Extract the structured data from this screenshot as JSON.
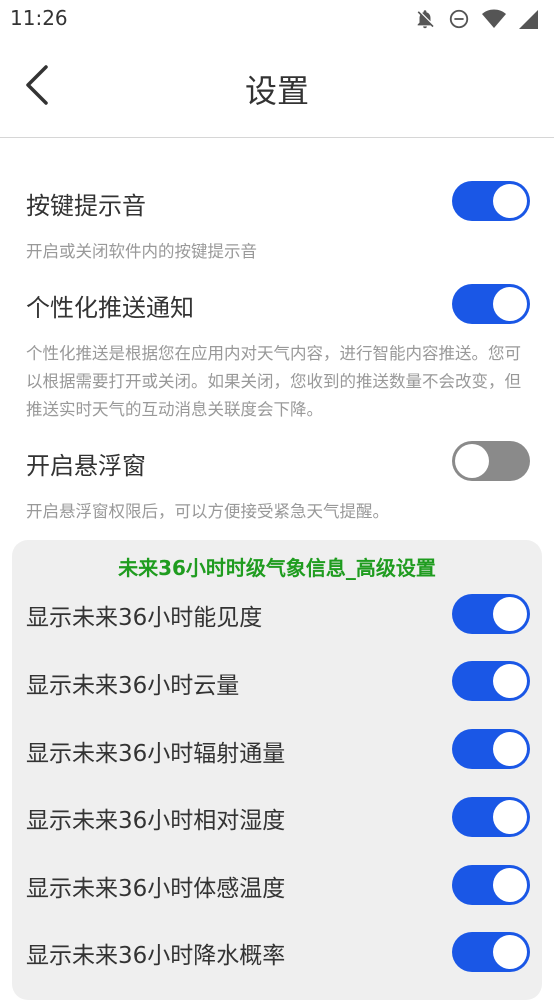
{
  "status_bar": {
    "time": "11:26",
    "icons": [
      "notifications-off-icon",
      "do-not-disturb-icon",
      "wifi-icon",
      "signal-icon"
    ]
  },
  "app_bar": {
    "title": "设置",
    "back_icon": "chevron-left-icon"
  },
  "settings": [
    {
      "title": "按键提示音",
      "description": "开启或关闭软件内的按键提示音",
      "enabled": true
    },
    {
      "title": "个性化推送通知",
      "description": "个性化推送是根据您在应用内对天气内容，进行智能内容推送。您可以根据需要打开或关闭。如果关闭，您收到的推送数量不会改变，但推送实时天气的互动消息关联度会下降。",
      "enabled": true
    },
    {
      "title": "开启悬浮窗",
      "description": "开启悬浮窗权限后，可以方便接受紧急天气提醒。",
      "enabled": false
    }
  ],
  "advanced": {
    "title": "未来36小时时级气象信息_高级设置",
    "title_color": "#1f9c1f",
    "items": [
      {
        "label": "显示未来36小时能见度",
        "enabled": true
      },
      {
        "label": "显示未来36小时云量",
        "enabled": true
      },
      {
        "label": "显示未来36小时辐射通量",
        "enabled": true
      },
      {
        "label": "显示未来36小时相对湿度",
        "enabled": true
      },
      {
        "label": "显示未来36小时体感温度",
        "enabled": true
      },
      {
        "label": "显示未来36小时降水概率",
        "enabled": true
      }
    ]
  },
  "colors": {
    "toggle_on": "#1a57e6",
    "toggle_off": "#8a8a8a"
  }
}
